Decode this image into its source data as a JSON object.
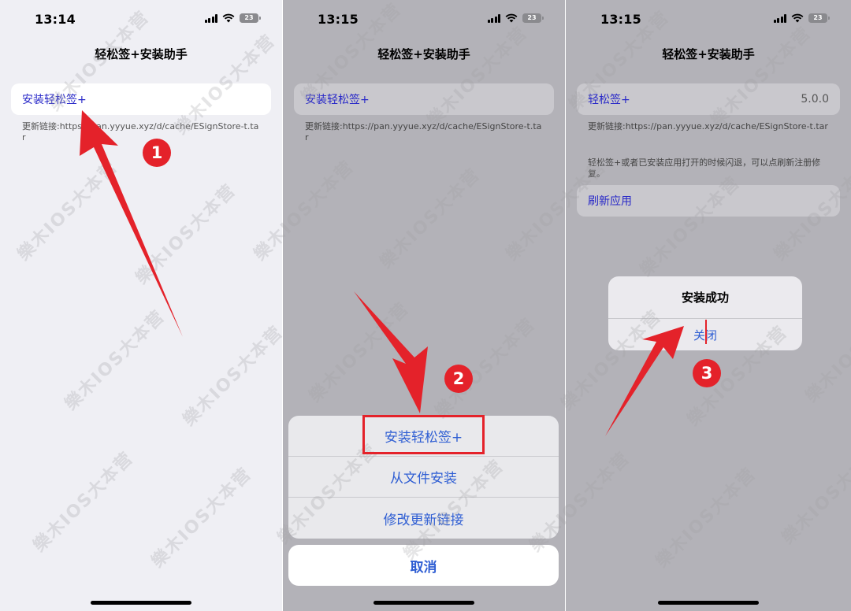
{
  "panels": [
    {
      "time": "13:14",
      "battery": "23",
      "title": "轻松签+安装助手",
      "install_cell": {
        "label": "安装轻松签+"
      },
      "footer": "更新链接:https://pan.yyyue.xyz/d/cache/ESignStore-t.tar"
    },
    {
      "time": "13:15",
      "battery": "23",
      "title": "轻松签+安装助手",
      "install_cell": {
        "label": "安装轻松签+"
      },
      "footer": "更新链接:https://pan.yyyue.xyz/d/cache/ESignStore-t.tar",
      "action_sheet": {
        "options": [
          "安装轻松签+",
          "从文件安装",
          "修改更新链接"
        ],
        "cancel": "取消"
      }
    },
    {
      "time": "13:15",
      "battery": "23",
      "title": "轻松签+安装助手",
      "app_cell": {
        "label": "轻松签+",
        "version": "5.0.0"
      },
      "footer": "更新链接:https://pan.yyyue.xyz/d/cache/ESignStore-t.tar",
      "note": "轻松签+或者已安装应用打开的时候闪退，可以点刷新注册修复。",
      "refresh_cell": {
        "label": "刷新应用"
      },
      "alert": {
        "title": "安装成功",
        "button": "关闭"
      }
    }
  ],
  "annotations": {
    "step_numbers": [
      "1",
      "2",
      "3"
    ],
    "accent_color": "#e4222a"
  },
  "watermark": "樂木IOS大本营",
  "colors": {
    "link_blue": "#2f5ed3",
    "cell_blue": "#2828c8",
    "dim_bg": "#b3b2b8",
    "light_bg": "#efeff4"
  }
}
